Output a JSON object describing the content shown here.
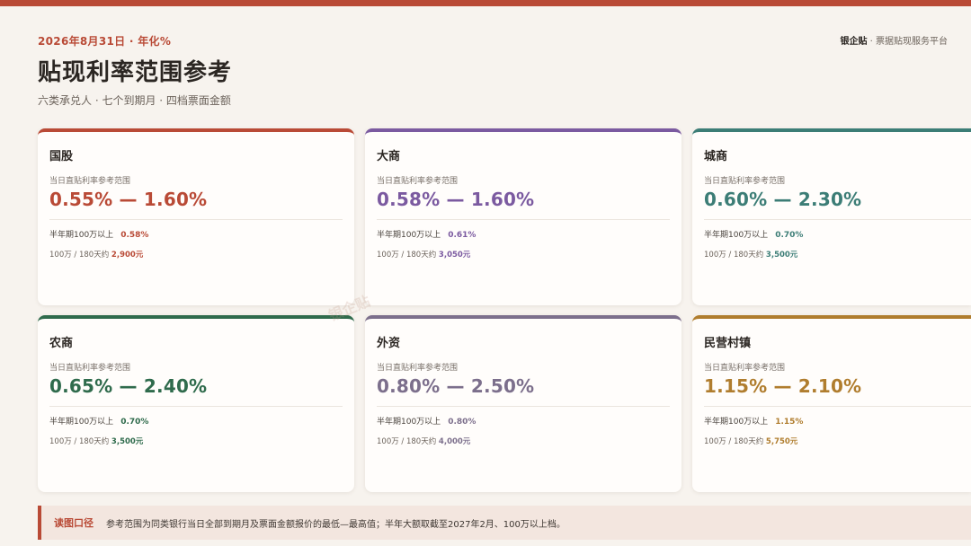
{
  "header": {
    "date_line": "2026年8月31日 · 年化%",
    "brand_name": "银企贴",
    "brand_tagline": " · 票据贴现服务平台",
    "title": "贴现利率范围参考",
    "subtitle": "六类承兑人 · 七个到期月 · 四档票面金额"
  },
  "cards": [
    {
      "name": "国股",
      "label": "当日直贴利率参考范围",
      "range": "0.55% — 1.60%",
      "row1_label": "半年期100万以上",
      "row1_value": "0.58%",
      "row2_label": "100万 / 180天约 ",
      "row2_value": "2,900元",
      "color": "#b94a36"
    },
    {
      "name": "大商",
      "label": "当日直贴利率参考范围",
      "range": "0.58% — 1.60%",
      "row1_label": "半年期100万以上",
      "row1_value": "0.61%",
      "row2_label": "100万 / 180天约 ",
      "row2_value": "3,050元",
      "color": "#7b5aa0"
    },
    {
      "name": "城商",
      "label": "当日直贴利率参考范围",
      "range": "0.60% — 2.30%",
      "row1_label": "半年期100万以上",
      "row1_value": "0.70%",
      "row2_label": "100万 / 180天约 ",
      "row2_value": "3,500元",
      "color": "#3c7d76"
    },
    {
      "name": "农商",
      "label": "当日直贴利率参考范围",
      "range": "0.65% — 2.40%",
      "row1_label": "半年期100万以上",
      "row1_value": "0.70%",
      "row2_label": "100万 / 180天约 ",
      "row2_value": "3,500元",
      "color": "#2f6b4c"
    },
    {
      "name": "外资",
      "label": "当日直贴利率参考范围",
      "range": "0.80% — 2.50%",
      "row1_label": "半年期100万以上",
      "row1_value": "0.80%",
      "row2_label": "100万 / 180天约 ",
      "row2_value": "4,000元",
      "color": "#7c6f8c"
    },
    {
      "name": "民营村镇",
      "label": "当日直贴利率参考范围",
      "range": "1.15% — 2.10%",
      "row1_label": "半年期100万以上",
      "row1_value": "1.15%",
      "row2_label": "100万 / 180天约 ",
      "row2_value": "5,750元",
      "color": "#b07d2e"
    }
  ],
  "watermark": "银企贴",
  "note": {
    "title": "读图口径",
    "text": "参考范围为同类银行当日全部到期月及票面金额报价的最低—最高值；半年大额取截至2027年2月、100万以上档。"
  }
}
